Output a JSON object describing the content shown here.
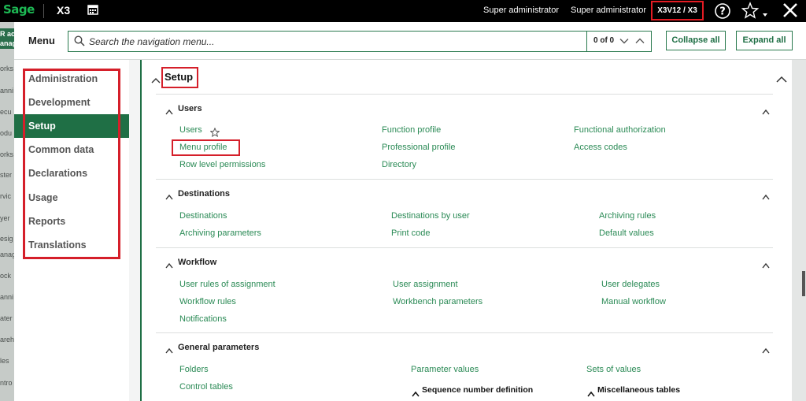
{
  "topbar": {
    "logo": "Sage",
    "product": "X3",
    "user_name": "Super administrator",
    "user_role": "Super administrator",
    "folder": "X3V12 / X3",
    "icons": {
      "calendar": "calendar-icon",
      "help": "help-icon",
      "star": "star-icon",
      "close": "close-icon"
    }
  },
  "background_strip": [
    "R ac",
    "anag",
    "orks",
    "anni",
    "ecu",
    "odu",
    "orks",
    "ster",
    "rvic",
    "yer",
    "esig",
    "anag",
    "ock",
    "anni",
    "ater",
    "areh",
    "les",
    "ntro"
  ],
  "menu": {
    "title": "Menu",
    "search_placeholder": "Search the navigation menu...",
    "search_value": "",
    "count": "0 of 0",
    "collapse_label": "Collapse all",
    "expand_label": "Expand all"
  },
  "nav": {
    "items": [
      {
        "label": "Administration",
        "active": false
      },
      {
        "label": "Development",
        "active": false
      },
      {
        "label": "Setup",
        "active": true
      },
      {
        "label": "Common data",
        "active": false
      },
      {
        "label": "Declarations",
        "active": false
      },
      {
        "label": "Usage",
        "active": false
      },
      {
        "label": "Reports",
        "active": false
      },
      {
        "label": "Translations",
        "active": false
      }
    ]
  },
  "main": {
    "title": "Setup",
    "sections": [
      {
        "title": "Users",
        "columns": [
          [
            "Users",
            "Menu profile",
            "Row level permissions"
          ],
          [
            "Function profile",
            "Professional profile",
            "Directory"
          ],
          [
            "Functional authorization",
            "Access codes"
          ]
        ]
      },
      {
        "title": "Destinations",
        "columns": [
          [
            "Destinations",
            "Archiving parameters"
          ],
          [
            "Destinations by user",
            "Print code"
          ],
          [
            "Archiving rules",
            "Default values"
          ]
        ]
      },
      {
        "title": "Workflow",
        "columns": [
          [
            "User rules of assignment",
            "Workflow rules",
            "Notifications"
          ],
          [
            "User assignment",
            "Workbench parameters"
          ],
          [
            "User delegates",
            "Manual workflow"
          ]
        ]
      },
      {
        "title": "General parameters",
        "columns": [
          [
            "Folders",
            "Control tables"
          ],
          [
            "Parameter values"
          ],
          [
            "Sets of values"
          ]
        ],
        "subsections": [
          "Sequence number definition",
          "Miscellaneous tables"
        ]
      }
    ]
  },
  "colors": {
    "brand": "#1f6f45",
    "link": "#2a8a55",
    "highlight": "#d51f2a",
    "topbar": "#000000"
  }
}
